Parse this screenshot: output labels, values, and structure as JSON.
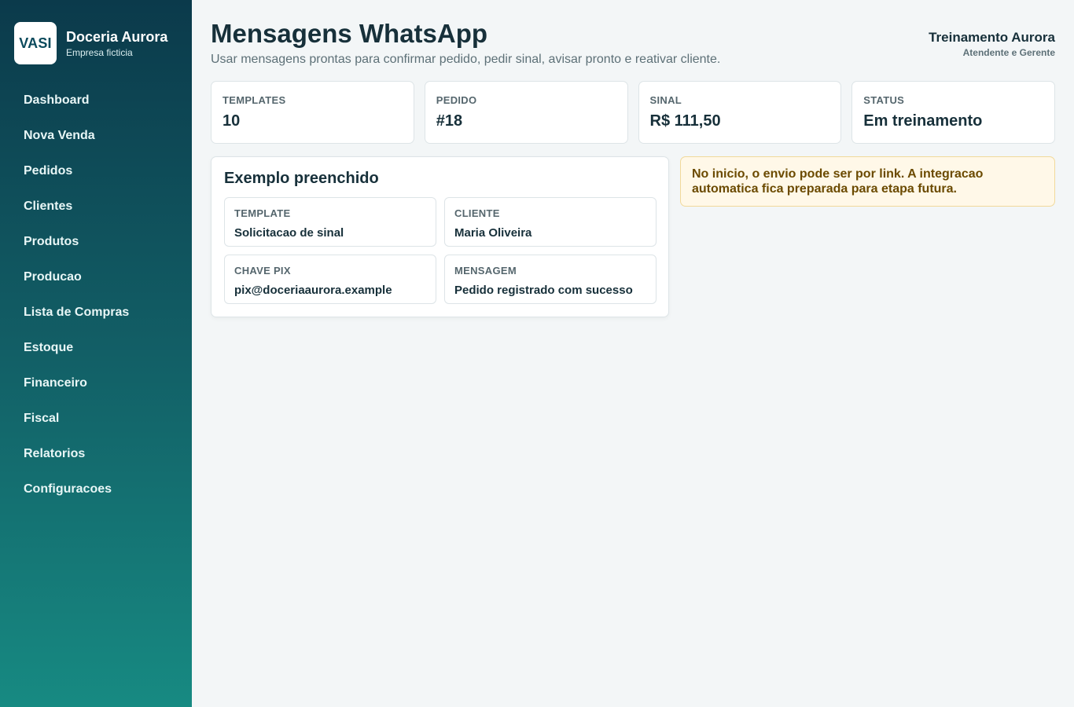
{
  "sidebar": {
    "logo_text": "VASI",
    "company_name": "Doceria Aurora",
    "company_sub": "Empresa ficticia",
    "items": [
      {
        "label": "Dashboard"
      },
      {
        "label": "Nova Venda"
      },
      {
        "label": "Pedidos"
      },
      {
        "label": "Clientes"
      },
      {
        "label": "Produtos"
      },
      {
        "label": "Producao"
      },
      {
        "label": "Lista de Compras"
      },
      {
        "label": "Estoque"
      },
      {
        "label": "Financeiro"
      },
      {
        "label": "Fiscal"
      },
      {
        "label": "Relatorios"
      },
      {
        "label": "Configuracoes"
      }
    ]
  },
  "header": {
    "title": "Mensagens WhatsApp",
    "subtitle": "Usar mensagens prontas para confirmar pedido, pedir sinal, avisar pronto e reativar cliente.",
    "user_name": "Treinamento Aurora",
    "user_role": "Atendente e Gerente"
  },
  "stats": [
    {
      "label": "TEMPLATES",
      "value": "10"
    },
    {
      "label": "PEDIDO",
      "value": "#18"
    },
    {
      "label": "SINAL",
      "value": "R$ 111,50"
    },
    {
      "label": "STATUS",
      "value": "Em treinamento"
    }
  ],
  "example": {
    "title": "Exemplo preenchido",
    "fields": [
      {
        "label": "TEMPLATE",
        "value": "Solicitacao de sinal"
      },
      {
        "label": "CLIENTE",
        "value": "Maria Oliveira"
      },
      {
        "label": "CHAVE PIX",
        "value": "pix@doceriaaurora.example"
      },
      {
        "label": "MENSAGEM",
        "value": "Pedido registrado com sucesso"
      }
    ]
  },
  "notice": {
    "text": "No inicio, o envio pode ser por link. A integracao automatica fica preparada para etapa futura."
  },
  "colors": {
    "sidebar_top": "#0b3a4b",
    "sidebar_bottom": "#178a82",
    "notice_bg": "#fff8e8",
    "notice_text": "#6b4a00"
  }
}
